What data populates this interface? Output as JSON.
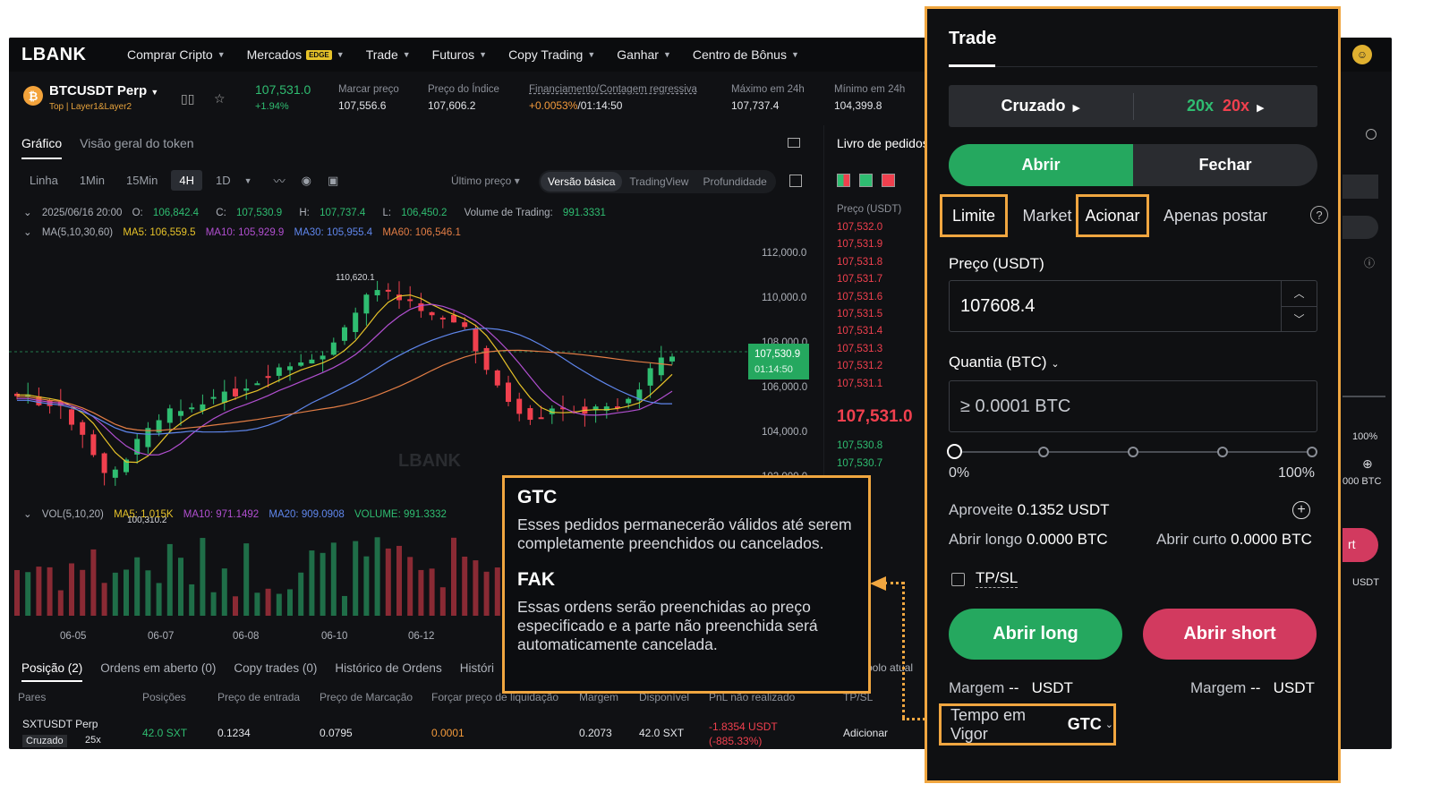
{
  "nav": {
    "logo": "LBANK",
    "items": [
      "Comprar Cripto",
      "Mercados",
      "Trade",
      "Futuros",
      "Copy Trading",
      "Ganhar",
      "Centro de Bônus"
    ],
    "badge": "EDGE"
  },
  "ticker": {
    "coin_glyph": "₿",
    "symbol": "BTCUSDT Perp",
    "tags": "Top | Layer1&Layer2",
    "last_price": "107,531.0",
    "change": "+1.94%",
    "mark_label": "Marcar preço",
    "mark_value": "107,556.6",
    "index_label": "Preço do Índice",
    "index_value": "107,606.2",
    "funding_label": "Financiamento/Contagem regressiva",
    "funding_rate": "+0.0053%",
    "funding_countdown": "/01:14:50",
    "high_label": "Máximo em 24h",
    "high_value": "107,737.4",
    "low_label": "Mínimo em 24h",
    "low_value": "104,399.8"
  },
  "chart": {
    "tabs": [
      "Gráfico",
      "Visão geral do token"
    ],
    "timeframes": [
      "Linha",
      "1Min",
      "15Min",
      "4H",
      "1D"
    ],
    "active_timeframe": "4H",
    "last_price_mode": "Último preço",
    "view_modes": [
      "Versão básica",
      "TradingView",
      "Profundidade"
    ],
    "ohlc": {
      "date": "2025/06/16 20:00",
      "o_label": "O:",
      "o": "106,842.4",
      "c_label": "C:",
      "c": "107,530.9",
      "h_label": "H:",
      "h": "107,737.4",
      "l_label": "L:",
      "l": "106,450.2",
      "vol_label": "Volume de Trading:",
      "vol": "991.3331"
    },
    "ma": {
      "label": "MA(5,10,30,60)",
      "ma5": "MA5: 106,559.5",
      "ma10": "MA10: 105,929.9",
      "ma30": "MA30: 105,955.4",
      "ma60": "MA60: 106,546.1"
    },
    "vol_ind": {
      "label": "VOL(5,10,20)",
      "ma5": "MA5: 1.015K",
      "ma10": "MA10: 971.1492",
      "ma20": "MA20: 909.0908",
      "volume": "VOLUME: 991.3332"
    },
    "y_ticks": [
      "112,000.0",
      "110,000.0",
      "108,000.0",
      "106,000.0",
      "104,000.0",
      "102,000.0"
    ],
    "x_ticks": [
      "06-05",
      "06-07",
      "06-08",
      "06-10",
      "06-12"
    ],
    "high_marker": "110,620.1",
    "low_marker": "100,310.2",
    "current_price_tag": "107,530.9",
    "countdown_tag": "01:14:50",
    "watermark": "LBANK"
  },
  "orderbook": {
    "title": "Livro de pedidos",
    "header": "Preço (USDT)",
    "asks": [
      "107,532.0",
      "107,531.9",
      "107,531.8",
      "107,531.7",
      "107,531.6",
      "107,531.5",
      "107,531.4",
      "107,531.3",
      "107,531.2",
      "107,531.1"
    ],
    "mid": "107,531.0",
    "bids": [
      "107,530.8",
      "107,530.7"
    ]
  },
  "positions": {
    "tabs": [
      "Posição (2)",
      "Ordens em aberto (0)",
      "Copy trades (0)",
      "Histórico de Ordens",
      "Históri"
    ],
    "headers": [
      "Pares",
      "Posições",
      "Preço de entrada",
      "Preço de Marcação",
      "Forçar preço de liquidação",
      "Margem",
      "Disponível",
      "PnL não realizado",
      "TP/SL"
    ],
    "row": {
      "pair": "SXTUSDT Perp",
      "mode": "Cruzado",
      "lev": "25x",
      "size": "42.0 SXT",
      "entry": "0.1234",
      "mark": "0.0795",
      "liq": "0.0001",
      "margin": "0.2073",
      "avail": "42.0 SXT",
      "pnl": "-1.8354 USDT",
      "pnl_pct": "(-885.33%)",
      "add": "Adicionar"
    },
    "side_label": "bolo atual"
  },
  "tooltip": {
    "gtc_title": "GTC",
    "gtc_desc": "Esses pedidos permanecerão válidos até serem completamente preenchidos ou cancelados.",
    "fak_title": "FAK",
    "fak_desc": "Essas ordens serão preenchidas ao preço especificado e a parte não preenchida será automaticamente cancelada."
  },
  "trade": {
    "title": "Trade",
    "margin_mode": "Cruzado",
    "lev_long": "20x",
    "lev_short": "20x",
    "open": "Abrir",
    "close": "Fechar",
    "order_types": [
      "Limite",
      "Market",
      "Acionar",
      "Apenas postar"
    ],
    "price_label": "Preço (USDT)",
    "price_value": "107608.4",
    "qty_label": "Quantia (BTC)",
    "qty_placeholder": "≥ 0.0001 BTC",
    "slider_min": "0%",
    "slider_max": "100%",
    "slider_value": 0,
    "avail_label": "Aproveite",
    "avail_value": "0.1352 USDT",
    "long_label": "Abrir longo",
    "long_value": "0.0000 BTC",
    "short_label": "Abrir curto",
    "short_value": "0.0000 BTC",
    "tpsl": "TP/SL",
    "btn_long": "Abrir long",
    "btn_short": "Abrir short",
    "margin_label": "Margem",
    "margin_value": "--",
    "margin_unit": "USDT",
    "tif_label": "Tempo em Vigor",
    "tif_value": "GTC"
  },
  "right_strip": {
    "pct": "100%",
    "btc": "000 BTC",
    "btn_text": "rt",
    "usdt": "USDT"
  },
  "colors": {
    "accent_orange": "#f0a640",
    "buy_green": "#25a85f",
    "sell_red": "#d23a5f",
    "bg": "#101114"
  }
}
